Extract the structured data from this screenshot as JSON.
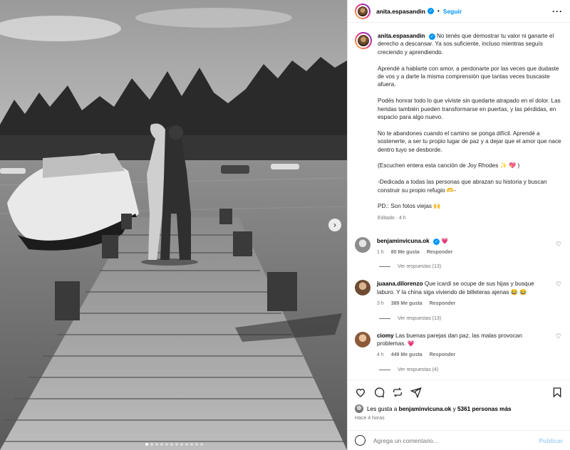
{
  "post": {
    "username": "anita.espasandin",
    "separator": "•",
    "follow_label": "Seguir",
    "more_icon": "more-horizontal-icon"
  },
  "caption": {
    "username": "anita.espasandin",
    "paragraphs": [
      "No tenés que demostrar tu valor ni ganarte el derecho a descansar. Ya sos suficiente, incluso mientras seguís creciendo y aprendiendo.",
      "Aprendé a hablarte con amor, a perdonarte por las veces que dudaste de vos y a darte la misma comprensión que tantas veces buscaste afuera.",
      "Podés honrar todo lo que viviste sin quedarte atrapado en el dolor. Las heridas también pueden transformarse en puertas, y las pérdidas, en espacio para algo nuevo.",
      "No te abandones cuando el camino se ponga difícil. Aprendé a sostenerte, a ser tu propio lugar de paz y a dejar que el amor que nace dentro tuyo se desborde.",
      "(Escuchen entera esta canción de Joy Rhodes ✨ 💖 )",
      "-Dedicada a todas las personas que abrazan su historia y buscan construir su propio refugio 🫶-",
      "PD.: Son fotos viejas 🙌"
    ],
    "edited": "Editado · 4 h"
  },
  "comments": [
    {
      "username": "benjaminvicuna.ok",
      "text": " 💗",
      "time": "1 h",
      "likes": "80 Me gusta",
      "reply_label": "Responder",
      "view_replies": "Ver respuestas (13)",
      "avatar_color": "#bdbdbd"
    },
    {
      "username": "juaana.dilorenzo",
      "text": " Que icardi se ocupe de sus hijas y busque laburo. Y la china siga viviendo de billeteras ajenas 😂 😂",
      "time": "3 h",
      "likes": "389 Me gusta",
      "reply_label": "Responder",
      "view_replies": "Ver respuestas (13)",
      "avatar_color": "#a07a5a"
    },
    {
      "username": "ciomy",
      "text": " Las buenas parejas dan paz, las malas provocan problemas. 💗",
      "time": "4 h",
      "likes": "449 Me gusta",
      "reply_label": "Responder",
      "view_replies": "Ver respuestas (4)",
      "avatar_color": "#c98a5c"
    }
  ],
  "actions": {
    "like_icon": "heart-icon",
    "comment_icon": "comment-icon",
    "share_icon": "repost-icon",
    "send_icon": "send-icon",
    "save_icon": "bookmark-icon"
  },
  "likes": {
    "prefix": "Les gusta a ",
    "user": "benjaminvicuna.ok",
    "middle": " y ",
    "others": "5361 personas más",
    "time": "Hace 4 horas"
  },
  "add_comment": {
    "placeholder": "Agrega un comentario...",
    "publish_label": "Publicar"
  },
  "carousel": {
    "next_glyph": "›",
    "dot_count": 12,
    "active_index": 0
  },
  "colors": {
    "accent": "#0095f6",
    "publish_disabled": "#a5d3fb",
    "muted": "#737373"
  }
}
